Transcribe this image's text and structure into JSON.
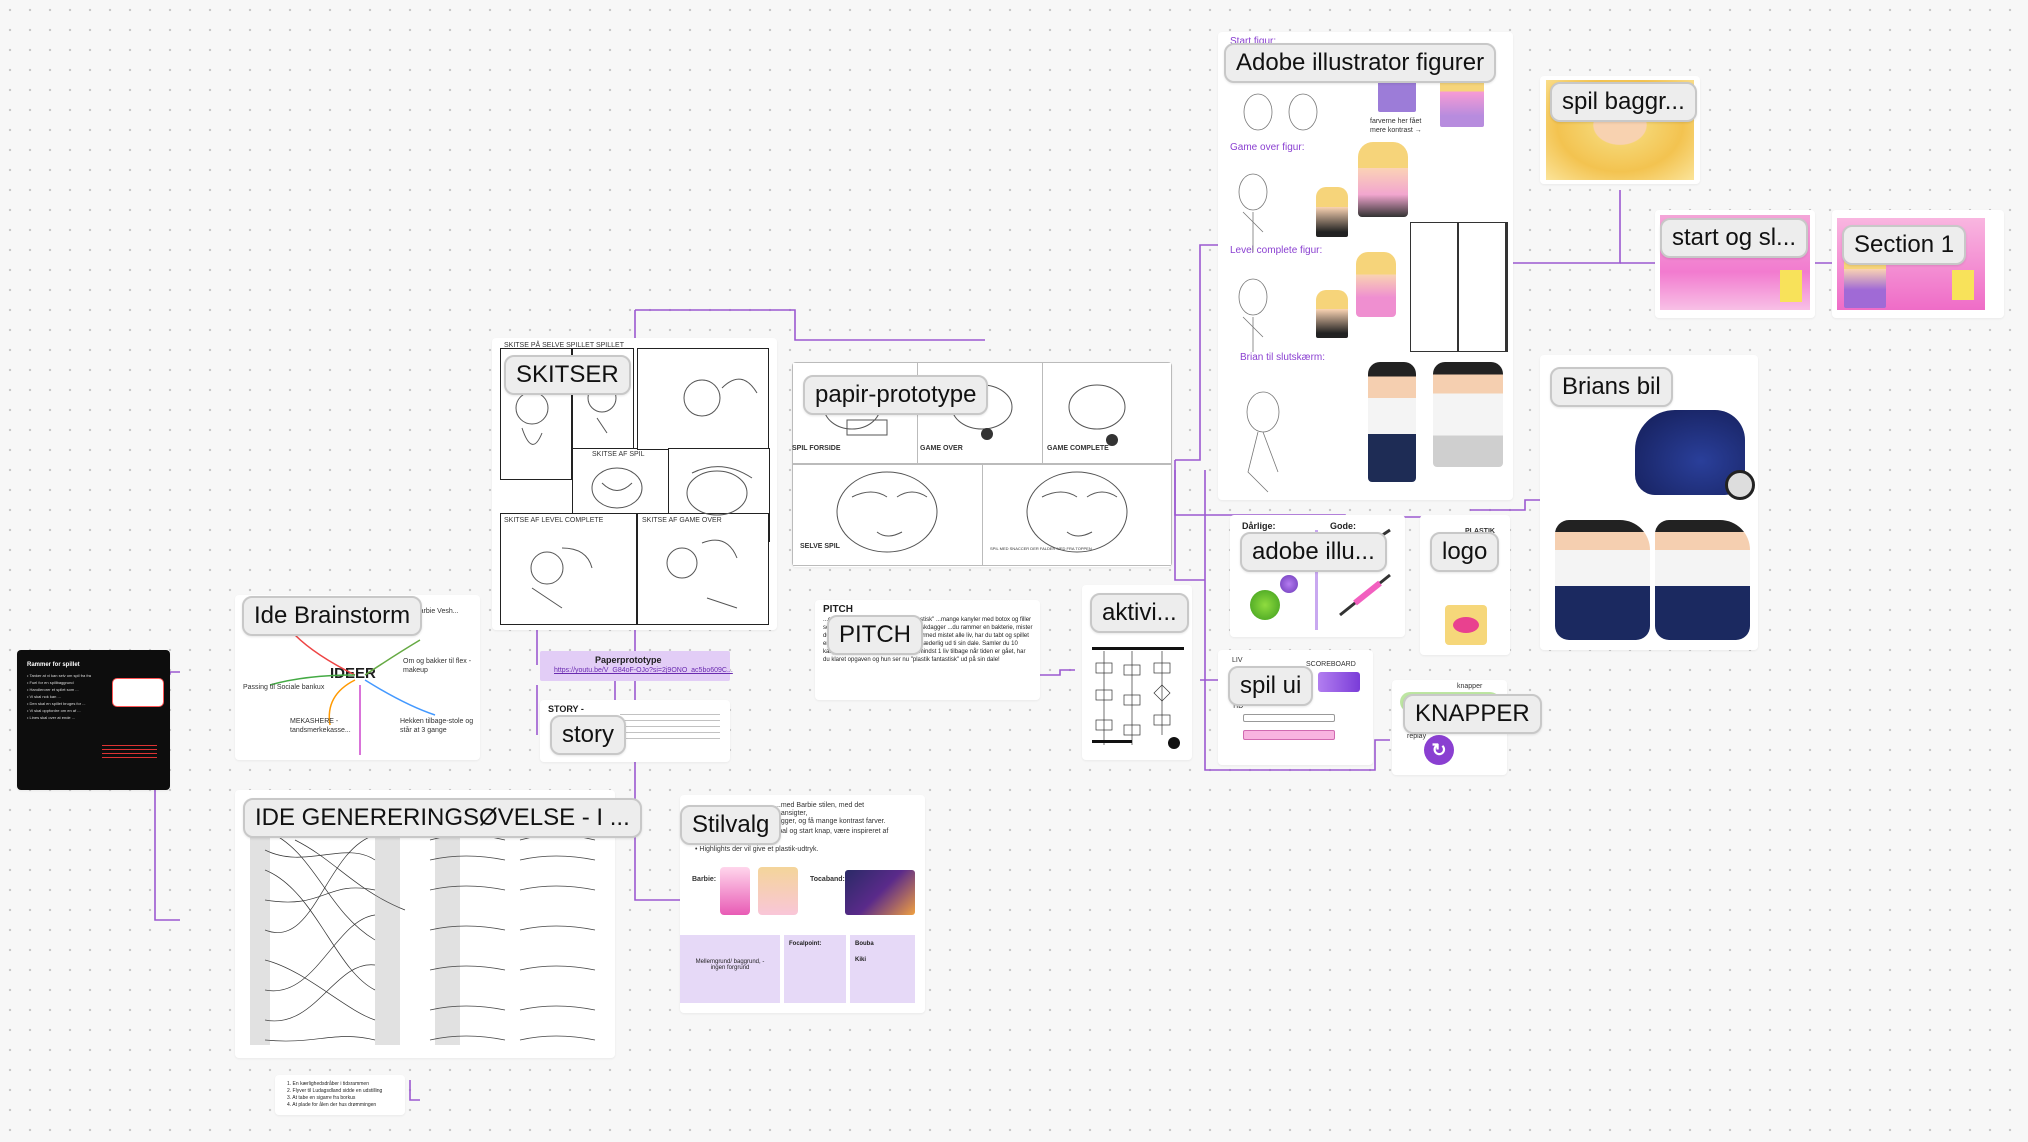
{
  "cards": {
    "rammer_title": "Rammer for spillet",
    "ide_brainstorm": "Ide Brainstorm",
    "ideer": "IDEER",
    "skitser": "SKITSER",
    "papir_prototype": "papir-prototype",
    "pitch": "PITCH",
    "pitch_header": "PITCH",
    "paperprototype_label": "Paperprototype",
    "paperprototype_link": "https://youtu.be/V_G84oF-OJo?si=2j9ONO_ac5bo609C...",
    "story_header": "STORY -",
    "story": "story",
    "ide_generering": "IDE GENERERINGSØVELSE - I ...",
    "stilvalg": "Stilvalg",
    "aktivi": "aktivi...",
    "adobe_illustrator_figurer": "Adobe illustrator figurer",
    "adobe_illu": "adobe illu...",
    "spil_ui": "spil ui",
    "logo": "logo",
    "knapper": "KNAPPER",
    "spil_baggr": "spil baggr...",
    "start_og_sl": "start og sl...",
    "section_1": "Section 1",
    "brians_bil": "Brians bil"
  },
  "adobe_labels": {
    "start_figur": "Start figur:",
    "game_over_figur": "Game over figur:",
    "level_complete_figur": "Level complete figur:",
    "brian_til_slutskaerm": "Brian til slutskærm:",
    "farverne_note": "farverne her fået mere kontrast →"
  },
  "papir_labels": {
    "spil_forside": "SPIL FORSIDE",
    "game_over": "GAME OVER",
    "game_complete": "GAME COMPLETE",
    "selve_spil": "SELVE SPIL",
    "spil_med": "SPIL MED SNACCER DER FALDER MED FRA TOPPEN"
  },
  "skitser_labels": {
    "s1": "SKITSE PÅ SELVE SPILLET SPILLET",
    "s2": "SKITSE AF SPIL",
    "s3": "SKITSE AF LEVEL COMPLETE",
    "s4": "SKITSE AF GAME OVER"
  },
  "pitch_text": "...g kvinde med at blive \"plastik fantastisk\" ...mange kanyler med botox og filler som ...tene, da de går i sårene og adskdagger ...du rammer en bakterie, mister du et liv. Har du rørt 3 bakterier og dermed mistet alle liv, har du tabt og spillet er slut, og den unge kvinde ser ud forlæderlig ud ti sin dale. Samler du 10 kanyler (1000 points), og stadig har mindst 1 liv tilbage når tiden er gået, har du klaret opgaven og hun ser nu \"plastik fantastisk\" ud på sin dale!",
  "stilvalg_text": {
    "line1": "...med Barbie stilen, med det",
    "line2": "...ansigter,",
    "line3": "...gger, og få mange kontrast farver.",
    "line4": "Derudover vil mn slå på Tribal og start knap, være inspireret af Toca-Band stile.",
    "line5": "• Highlights der vil give et plastik-udtryk.",
    "barbie": "Barbie:",
    "tocaband": "Tocaband:",
    "mellemgrund": "Mellemgrund/ baggrund, - ingen forgrund",
    "focalpoint": "Focalpoint:",
    "bouba": "Bouba",
    "kiki": "Kiki"
  },
  "adobe_illu_labels": {
    "daarlige": "Dårlige:",
    "gode": "Gode:",
    "plastik": "PLASTIK"
  },
  "spil_ui_labels": {
    "liv": "LIV",
    "scoreboard": "SCOREBOARD",
    "tid": "TID"
  },
  "knapper_labels": {
    "knapper_small": "knapper",
    "replay": "replay"
  },
  "ide_list": "1. En kærlighedsdråber i tidsrammen\n2. Flyver til Ludagsdland sidde en udstilling\n3. At tabe en sigarre fra borkus\n4. At plade for ålen der hus drømmingen",
  "brainstorm_notes": {
    "left": "Passing til Sociale bankux",
    "right1": "Om og bakker til flex - makeup",
    "right2": "Barbie Vesh...",
    "bottom_left": "MEKASHERE - tandsmerkekasse...",
    "bottom_right": "Hekken tilbage-stole og står at 3 gange"
  },
  "rammer_lines": [
    "• Tanker at vi kan selv om spil fra fra",
    "• Fuel for en spillbaggrund",
    "• Handlerorer et spilet som ...",
    "• Vi skal nok kan ...",
    "• Den skal en spillet bruges for ...",
    "• Vi skal oppfordre om en af ...",
    "• Lines skal over at ende ..."
  ],
  "colors": {
    "accent": "#9b59d0",
    "pill_bg": "#ededed",
    "purple_light": "#e6d9f7",
    "pink": "#f46fd0"
  }
}
